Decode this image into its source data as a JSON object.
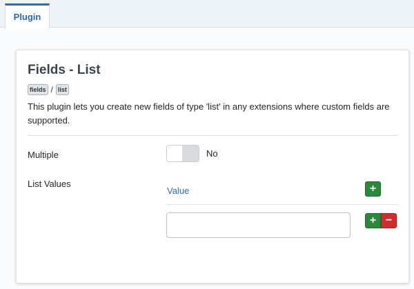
{
  "tabs": [
    {
      "label": "Plugin"
    }
  ],
  "plugin": {
    "title": "Fields - List",
    "badges": [
      "fields",
      "list"
    ],
    "badge_separator": "/",
    "description": "This plugin lets you create new fields of type 'list' in any extensions where custom fields are supported."
  },
  "form": {
    "multiple_label": "Multiple",
    "multiple_value": "No",
    "list_values_label": "List Values",
    "value_column_header": "Value",
    "value_input": "",
    "add_symbol": "+",
    "remove_symbol": "−"
  },
  "colors": {
    "accent": "#2a69b8",
    "add_button": "#2a8a3c",
    "remove_button": "#cf2d2d"
  },
  "icons": [
    "plus-icon",
    "minus-icon"
  ]
}
